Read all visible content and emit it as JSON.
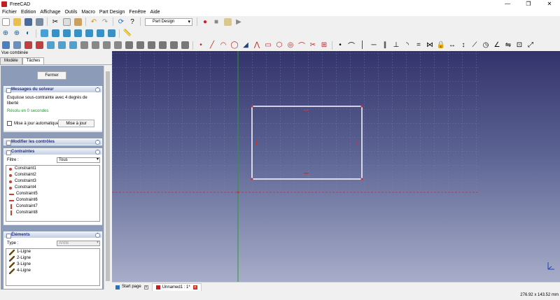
{
  "window": {
    "title": "FreeCAD",
    "controls": [
      "—",
      "❐",
      "✕"
    ]
  },
  "menu": [
    "Fichier",
    "Edition",
    "Affichage",
    "Outils",
    "Macro",
    "Part Design",
    "Fenêtre",
    "Aide"
  ],
  "toolbar": {
    "workbench": "Part Design"
  },
  "combo_view": {
    "title": "Vue combinée",
    "tabs": [
      "Modèle",
      "Tâches"
    ],
    "active_tab": "Tâches",
    "close_button": "Fermer"
  },
  "solver_messages": {
    "title": "Messages du solveur",
    "message": "Esquisse sous-contrainte avec 4 degrés de liberté",
    "status": "Résolu en 0 secondes",
    "status_color": "#1f9b2b",
    "auto_update_label": "Mise à jour automatique",
    "update_button": "Mise à jour"
  },
  "edit_controls": {
    "title": "Modifier les contrôles"
  },
  "constraints": {
    "title": "Contraintes",
    "filter_label": "Filtre :",
    "filter_value": "Tous",
    "items": [
      {
        "label": "Constraint1",
        "icon": "point"
      },
      {
        "label": "Constraint2",
        "icon": "point"
      },
      {
        "label": "Constraint3",
        "icon": "point"
      },
      {
        "label": "Constraint4",
        "icon": "point"
      },
      {
        "label": "Constraint5",
        "icon": "horizontal"
      },
      {
        "label": "Constraint6",
        "icon": "horizontal"
      },
      {
        "label": "Constraint7",
        "icon": "vertical"
      },
      {
        "label": "Constraint8",
        "icon": "vertical"
      }
    ]
  },
  "elements": {
    "title": "Éléments",
    "type_label": "Type :",
    "type_value": "Arête",
    "items": [
      "1-Ligne",
      "2-Ligne",
      "3-Ligne",
      "4-Ligne"
    ]
  },
  "documents": [
    {
      "label": "Start page",
      "active": false
    },
    {
      "label": "Unnamed1 : 1*",
      "active": true
    }
  ],
  "status": {
    "coordinates": "276.92 x 143.52 mm"
  },
  "colors": {
    "accent_blue": "#20307a",
    "constraint_red": "#c84030",
    "sketch_white": "#ffffff"
  }
}
